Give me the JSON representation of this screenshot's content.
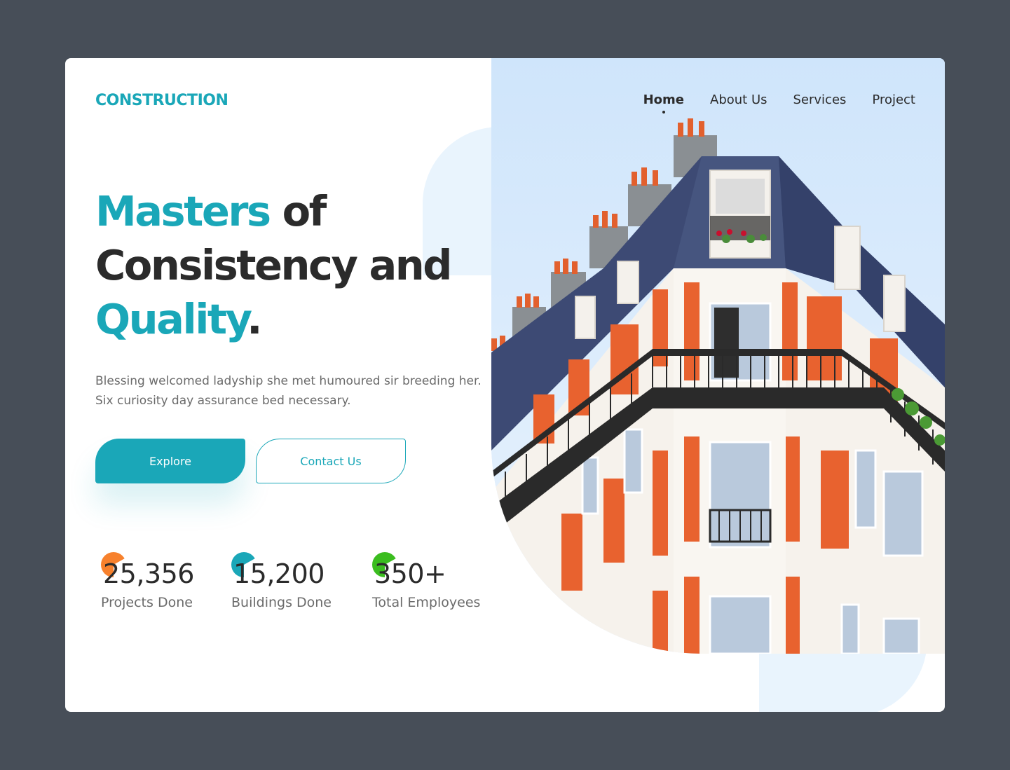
{
  "brand": {
    "logo": "CONSTRUCTION",
    "accent_color": "#1aa7b8"
  },
  "nav": {
    "items": [
      {
        "label": "Home",
        "active": true
      },
      {
        "label": "About Us",
        "active": false
      },
      {
        "label": "Services",
        "active": false
      },
      {
        "label": "Project",
        "active": false
      }
    ]
  },
  "hero": {
    "title_word1": "Masters",
    "title_word2": " of",
    "title_line2": "Consistency and",
    "title_word3": "Quality",
    "title_end": ".",
    "description": "Blessing welcomed ladyship she met humoured sir breeding her. Six curiosity day assurance bed necessary.",
    "explore_label": "Explore",
    "contact_label": "Contact Us"
  },
  "stats": [
    {
      "value": "25,356",
      "label": "Projects Done",
      "dot_color": "#f7812d"
    },
    {
      "value": "15,200",
      "label": "Buildings Done",
      "dot_color": "#1aa7b8"
    },
    {
      "value": "350+",
      "label": "Total Employees",
      "dot_color": "#3bbd1f"
    }
  ],
  "photo": {
    "icon": "building-photo"
  }
}
